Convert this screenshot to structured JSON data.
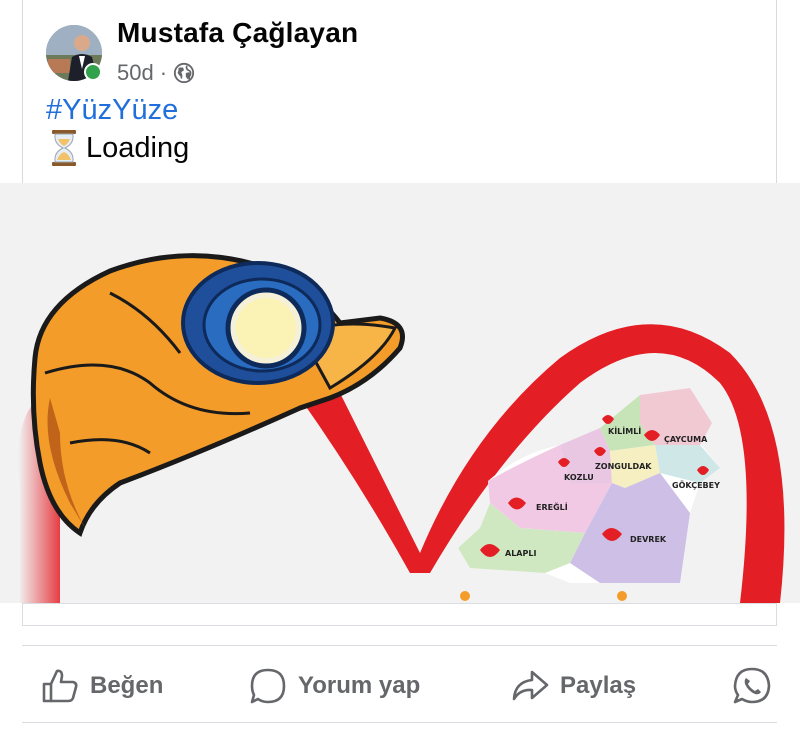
{
  "post": {
    "author": "Mustafa Çağlayan",
    "time": "50d",
    "separator": "·",
    "audience_icon": "globe-icon",
    "online": true,
    "hashtag": "#YüzYüze",
    "text": "Loading",
    "text_emoji_icon": "hourglass-icon"
  },
  "image": {
    "map_labels": [
      "KİLİMLİ",
      "ÇAYCUMA",
      "ZONGULDAK",
      "KOZLU",
      "GÖKÇEBEY",
      "EREĞLİ",
      "DEVREK",
      "ALAPLI"
    ]
  },
  "actions": [
    {
      "label": "Beğen",
      "icon": "like-icon"
    },
    {
      "label": "Yorum yap",
      "icon": "comment-icon"
    },
    {
      "label": "Paylaş",
      "icon": "share-icon"
    },
    {
      "label": "",
      "icon": "whatsapp-icon"
    }
  ],
  "colors": {
    "hashtag": "#216fdb",
    "secondary_text": "#65676b",
    "online": "#31a24c",
    "heart_red": "#e31e24",
    "helmet_orange": "#f39c2a",
    "lamp_blue": "#2a6cc0"
  }
}
